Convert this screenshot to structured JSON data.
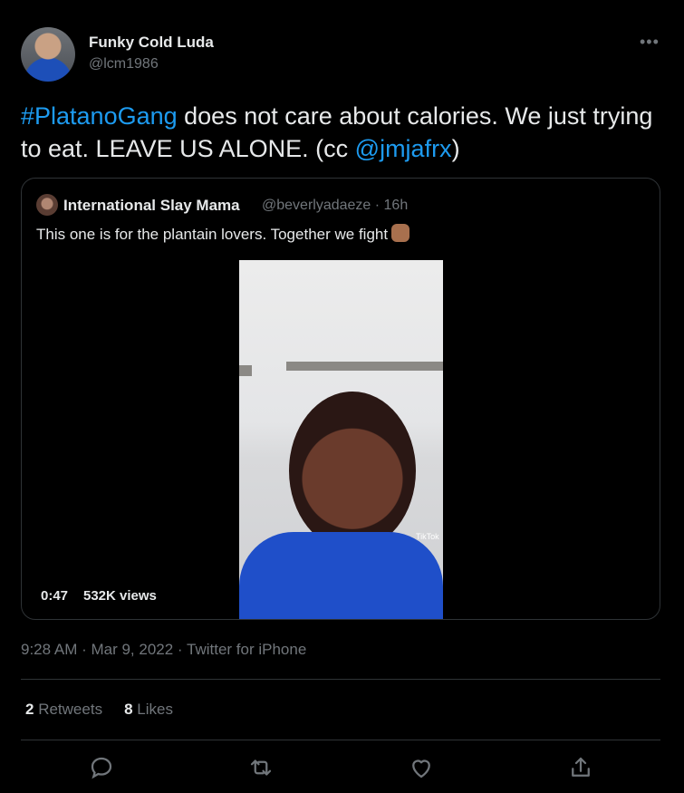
{
  "author": {
    "display_name": "Funky Cold Luda",
    "handle": "@lcm1986"
  },
  "more_label": "•••",
  "tweet": {
    "hashtag": "#PlatanoGang",
    "text_mid": " does not care about calories. We just trying to eat. LEAVE US ALONE. (cc ",
    "mention": "@jmjafrx",
    "text_end": ")"
  },
  "quote": {
    "display_name": "International Slay Mama",
    "handle_time": "@beverlyadaeze · 16h",
    "text": "This one is for the plantain lovers. Together we fight",
    "video": {
      "duration": "0:47",
      "views": "532K views",
      "watermark": "TikTok"
    }
  },
  "meta": "9:28 AM · Mar 9, 2022 · Twitter for iPhone",
  "stats": {
    "retweets_count": "2",
    "retweets_label": "Retweets",
    "likes_count": "8",
    "likes_label": "Likes"
  },
  "actions": [
    "reply-icon",
    "retweet-icon",
    "like-icon",
    "share-icon"
  ],
  "colors": {
    "background": "#000000",
    "text": "#e7e9ea",
    "secondary": "#71767b",
    "link": "#1d9bf0",
    "border": "#2f3336"
  }
}
